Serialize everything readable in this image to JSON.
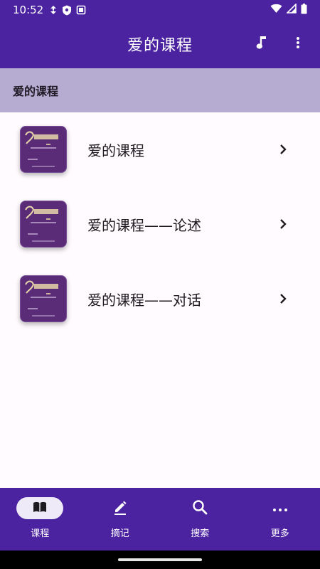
{
  "status_bar": {
    "time": "10:52"
  },
  "app_bar": {
    "title": "爱的课程"
  },
  "section": {
    "title": "爱的课程"
  },
  "courses": [
    {
      "label": "爱的课程"
    },
    {
      "label": "爱的课程——论述"
    },
    {
      "label": "爱的课程——对话"
    }
  ],
  "bottom_nav": [
    {
      "label": "课程",
      "icon": "book-icon",
      "active": true
    },
    {
      "label": "摘记",
      "icon": "pencil-icon",
      "active": false
    },
    {
      "label": "搜索",
      "icon": "search-icon",
      "active": false
    },
    {
      "label": "更多",
      "icon": "more-horizontal-icon",
      "active": false
    }
  ],
  "colors": {
    "primary": "#4b22a0",
    "section_header": "#b6abd1",
    "cover": "#5a2c78",
    "background": "#fffbfe"
  }
}
